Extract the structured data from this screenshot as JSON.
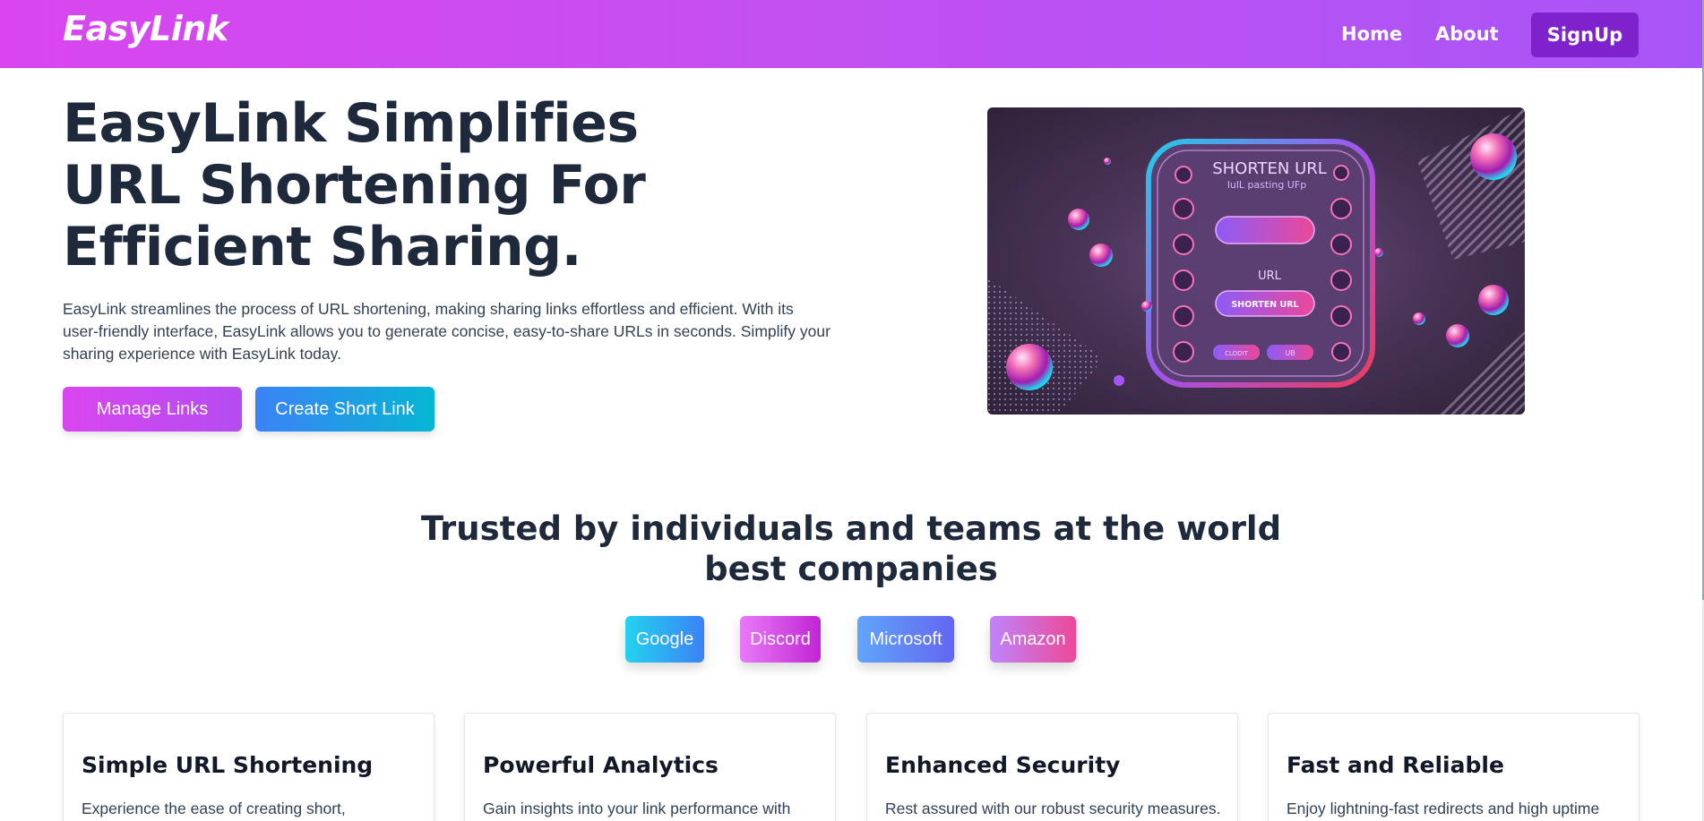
{
  "navbar": {
    "brand": "EasyLink",
    "links": [
      "Home",
      "About"
    ],
    "signup_label": "SignUp",
    "gradient": [
      "#d946ef",
      "#a855f7"
    ],
    "signup_color": "#7e22ce"
  },
  "hero": {
    "title": "EasyLink Simplifies URL Shortening For Efficient Sharing.",
    "description": "EasyLink streamlines the process of URL shortening, making sharing links effortless and efficient. With its user-friendly interface, EasyLink allows you to generate concise, easy-to-share URLs in seconds. Simplify your sharing experience with EasyLink today.",
    "manage_button": "Manage Links",
    "create_button": "Create Short Link",
    "image": {
      "heading": "SHORTEN URL",
      "subheading": "lulL pasting UFp",
      "field_label": "URL",
      "button_label": "SHORTEN URL",
      "small_button_1": "CLODIT",
      "small_button_2": "UB"
    }
  },
  "trusted": {
    "title": "Trusted by individuals and teams at the world best companies",
    "companies": [
      "Google",
      "Discord",
      "Microsoft",
      "Amazon"
    ]
  },
  "features": [
    {
      "title": "Simple URL Shortening",
      "text": "Experience the ease of creating short,"
    },
    {
      "title": "Powerful Analytics",
      "text": "Gain insights into your link performance with"
    },
    {
      "title": "Enhanced Security",
      "text": "Rest assured with our robust security measures."
    },
    {
      "title": "Fast and Reliable",
      "text": "Enjoy lightning-fast redirects and high uptime"
    }
  ]
}
